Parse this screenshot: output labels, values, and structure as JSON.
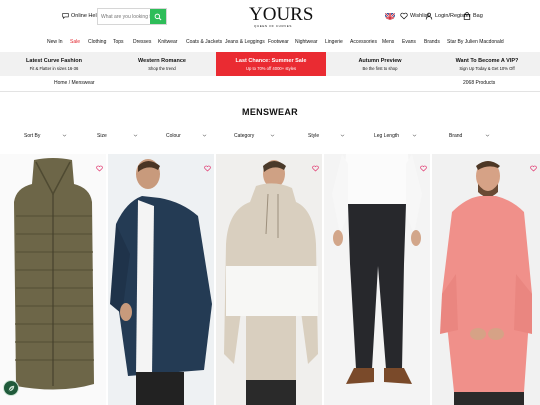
{
  "header": {
    "online_help": "Online Help",
    "search_placeholder": "What are you looking for?",
    "logo": "YOURS",
    "logo_tagline": "QUEEN OF CURVES",
    "wishlist": "Wishlist",
    "login": "Login/Register",
    "bag": "Bag"
  },
  "nav": [
    {
      "label": "New In",
      "color": "#111111"
    },
    {
      "label": "Sale",
      "color": "#e2242c"
    },
    {
      "label": "Clothing",
      "color": "#111111"
    },
    {
      "label": "Tops",
      "color": "#111111"
    },
    {
      "label": "Dresses",
      "color": "#111111"
    },
    {
      "label": "Knitwear",
      "color": "#111111"
    },
    {
      "label": "Coats & Jackets",
      "color": "#111111"
    },
    {
      "label": "Jeans & Leggings",
      "color": "#111111"
    },
    {
      "label": "Footwear",
      "color": "#111111"
    },
    {
      "label": "Nightwear",
      "color": "#111111"
    },
    {
      "label": "Lingerie",
      "color": "#111111"
    },
    {
      "label": "Accessories",
      "color": "#111111"
    },
    {
      "label": "Mens",
      "color": "#111111"
    },
    {
      "label": "Evans",
      "color": "#111111"
    },
    {
      "label": "Brands",
      "color": "#111111"
    },
    {
      "label": "Star By Julien Macdonald",
      "color": "#111111"
    }
  ],
  "promos": [
    {
      "title": "Latest Curve Fashion",
      "subtitle": "Fit & Flatter in sizes 16-36",
      "highlight": false
    },
    {
      "title": "Western Romance",
      "subtitle": "Shop the trend",
      "highlight": false
    },
    {
      "title": "Last Chance: Summer Sale",
      "subtitle": "Up to 70% off 4000+ styles",
      "highlight": true
    },
    {
      "title": "Autumn Preview",
      "subtitle": "Be the first to shop",
      "highlight": false
    },
    {
      "title": "Want To Become A VIP?",
      "subtitle": "Sign Up Today & Get 10% Off",
      "highlight": false
    }
  ],
  "breadcrumb": "Home / Menswear",
  "product_count": "2068 Products",
  "page_title": "MENSWEAR",
  "filters": [
    "Sort By",
    "Size",
    "Colour",
    "Category",
    "Style",
    "Leg Length",
    "Brand"
  ],
  "colors": {
    "accent_green": "#2ebd59",
    "sale_red": "#e2242c",
    "promo_red": "#ea2b32",
    "heart_pink": "#e0306a"
  },
  "products": [
    {
      "icon": "product-olive-padded-gilet"
    },
    {
      "icon": "product-navy-jacket-white-tee"
    },
    {
      "icon": "product-beige-white-colourblock-hoodie"
    },
    {
      "icon": "product-black-trousers-white-shirt"
    },
    {
      "icon": "product-pink-long-sleeve-shirt"
    }
  ]
}
